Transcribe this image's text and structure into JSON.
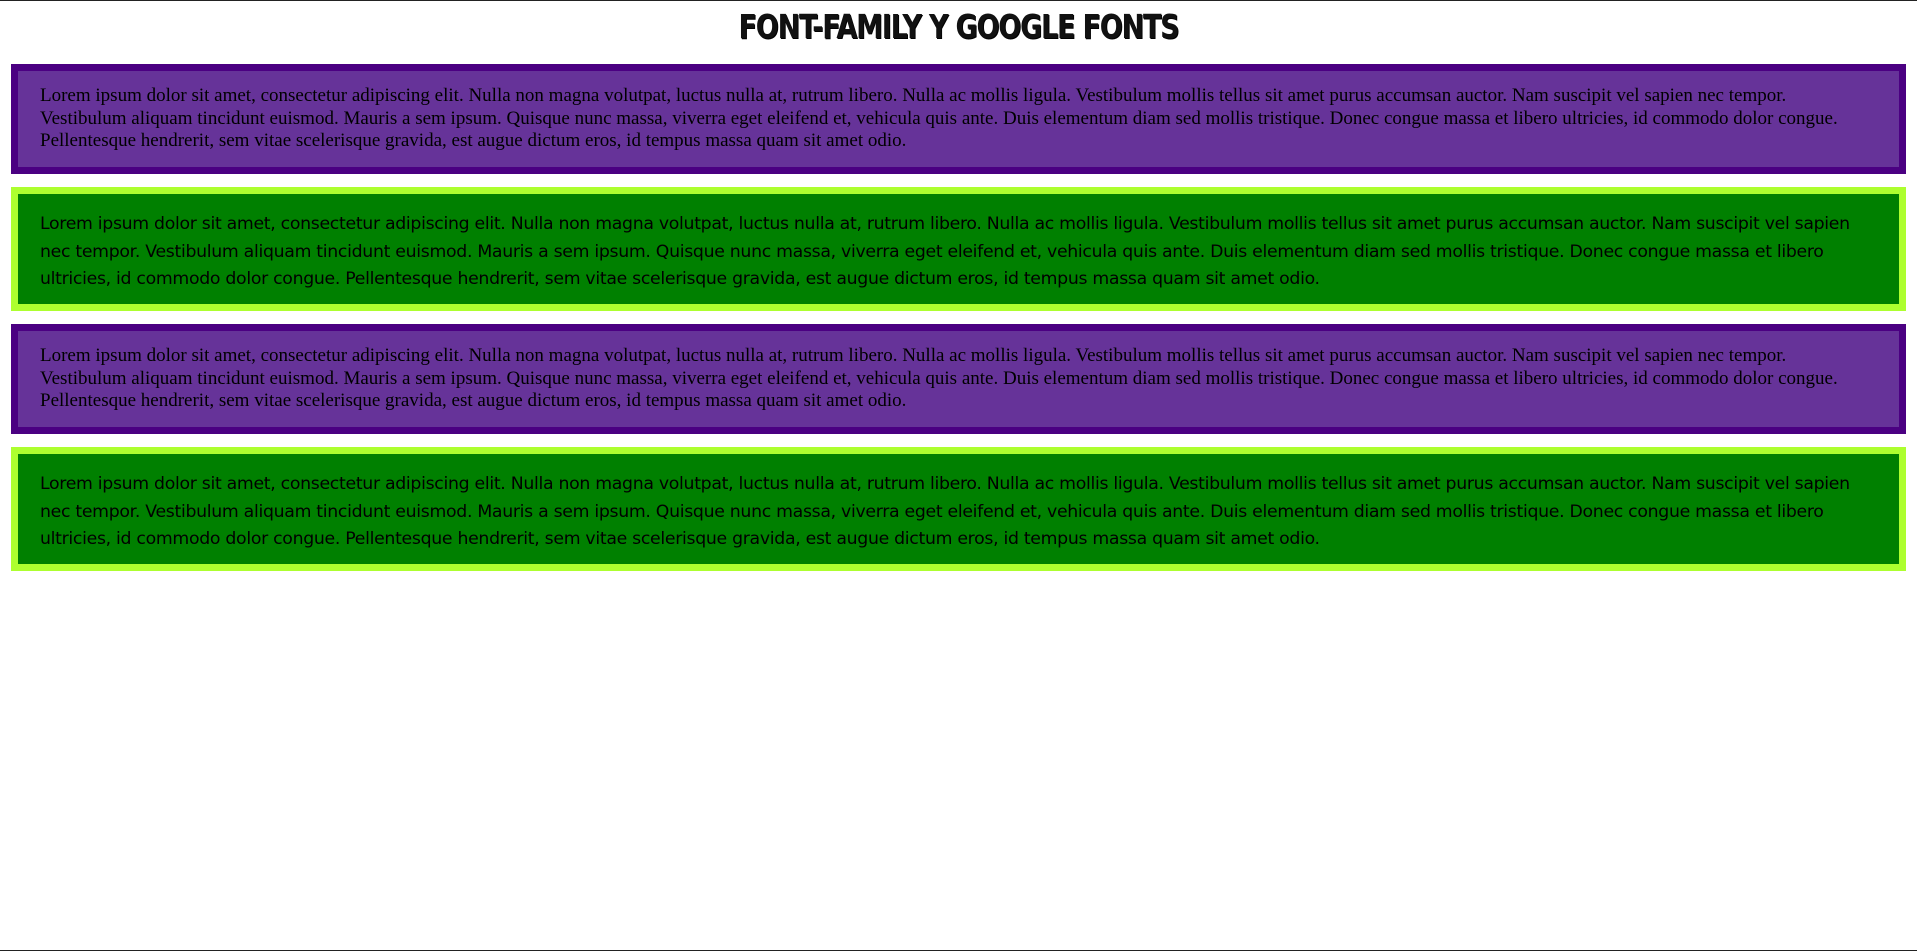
{
  "page": {
    "title": "FONT-FAMILY Y GOOGLE FONTS"
  },
  "colors": {
    "purple_fill": "#663399",
    "purple_border": "#4b0082",
    "green_fill": "#008000",
    "green_border": "#adff2f"
  },
  "boxes": [
    {
      "style": "purple",
      "text": "Lorem ipsum dolor sit amet, consectetur adipiscing elit. Nulla non magna volutpat, luctus nulla at, rutrum libero. Nulla ac mollis ligula. Vestibulum mollis tellus sit amet purus accumsan auctor. Nam suscipit vel sapien nec tempor. Vestibulum aliquam tincidunt euismod. Mauris a sem ipsum. Quisque nunc massa, viverra eget eleifend et, vehicula quis ante. Duis elementum diam sed mollis tristique. Donec congue massa et libero ultricies, id commodo dolor congue. Pellentesque hendrerit, sem vitae scelerisque gravida, est augue dictum eros, id tempus massa quam sit amet odio."
    },
    {
      "style": "green",
      "text": "Lorem ipsum dolor sit amet, consectetur adipiscing elit. Nulla non magna volutpat, luctus nulla at, rutrum libero. Nulla ac mollis ligula. Vestibulum mollis tellus sit amet purus accumsan auctor. Nam suscipit vel sapien nec tempor. Vestibulum aliquam tincidunt euismod. Mauris a sem ipsum. Quisque nunc massa, viverra eget eleifend et, vehicula quis ante. Duis elementum diam sed mollis tristique. Donec congue massa et libero ultricies, id commodo dolor congue. Pellentesque hendrerit, sem vitae scelerisque gravida, est augue dictum eros, id tempus massa quam sit amet odio."
    },
    {
      "style": "purple",
      "text": "Lorem ipsum dolor sit amet, consectetur adipiscing elit. Nulla non magna volutpat, luctus nulla at, rutrum libero. Nulla ac mollis ligula. Vestibulum mollis tellus sit amet purus accumsan auctor. Nam suscipit vel sapien nec tempor. Vestibulum aliquam tincidunt euismod. Mauris a sem ipsum. Quisque nunc massa, viverra eget eleifend et, vehicula quis ante. Duis elementum diam sed mollis tristique. Donec congue massa et libero ultricies, id commodo dolor congue. Pellentesque hendrerit, sem vitae scelerisque gravida, est augue dictum eros, id tempus massa quam sit amet odio."
    },
    {
      "style": "green",
      "text": "Lorem ipsum dolor sit amet, consectetur adipiscing elit. Nulla non magna volutpat, luctus nulla at, rutrum libero. Nulla ac mollis ligula. Vestibulum mollis tellus sit amet purus accumsan auctor. Nam suscipit vel sapien nec tempor. Vestibulum aliquam tincidunt euismod. Mauris a sem ipsum. Quisque nunc massa, viverra eget eleifend et, vehicula quis ante. Duis elementum diam sed mollis tristique. Donec congue massa et libero ultricies, id commodo dolor congue. Pellentesque hendrerit, sem vitae scelerisque gravida, est augue dictum eros, id tempus massa quam sit amet odio."
    }
  ]
}
